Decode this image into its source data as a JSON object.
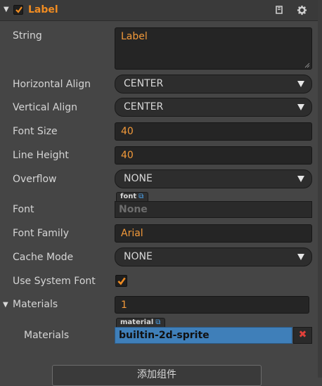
{
  "component": {
    "title": "Label",
    "enabled": true
  },
  "header": {
    "doc_icon": "book-icon",
    "settings_icon": "gear-icon"
  },
  "props": {
    "string_label": "String",
    "string_value": "Label",
    "halign_label": "Horizontal Align",
    "halign_value": "CENTER",
    "valign_label": "Vertical Align",
    "valign_value": "CENTER",
    "fontsize_label": "Font Size",
    "fontsize_value": "40",
    "lineheight_label": "Line Height",
    "lineheight_value": "40",
    "overflow_label": "Overflow",
    "overflow_value": "NONE",
    "font_label": "Font",
    "font_tag": "font",
    "font_value": "None",
    "fontfamily_label": "Font Family",
    "fontfamily_value": "Arial",
    "cachemode_label": "Cache Mode",
    "cachemode_value": "NONE",
    "systemfont_label": "Use System Font",
    "systemfont_checked": true,
    "materials_label": "Materials",
    "materials_count": "1",
    "material_item_label": "Materials",
    "material_tag": "material",
    "material_value": "builtin-2d-sprite",
    "material_remove": "✖"
  },
  "footer": {
    "add_component": "添加组件"
  },
  "colors": {
    "accent": "#f08c22",
    "selected": "#3f7fb9",
    "remove": "#e0403a"
  }
}
